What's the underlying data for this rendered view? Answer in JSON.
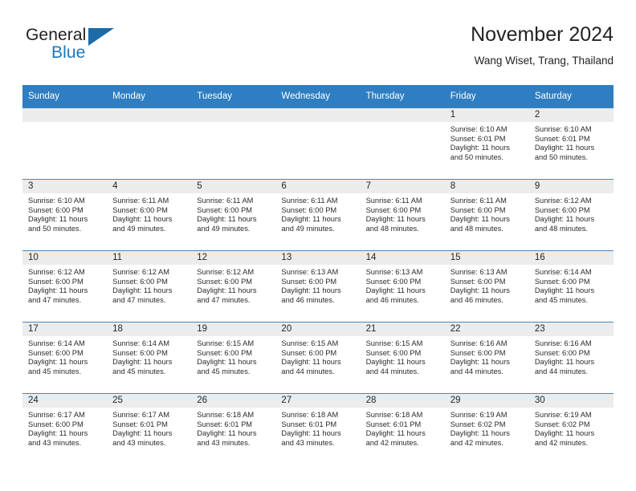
{
  "brand": {
    "name_top": "General",
    "name_bottom": "Blue",
    "accent_color": "#1b6ca8",
    "logo_icon": "triangle-flag-icon"
  },
  "header": {
    "title": "November 2024",
    "subtitle": "Wang Wiset, Trang, Thailand"
  },
  "calendar": {
    "header_bg": "#2f7ec1",
    "daynum_bg": "#ececec",
    "weekdays": [
      "Sunday",
      "Monday",
      "Tuesday",
      "Wednesday",
      "Thursday",
      "Friday",
      "Saturday"
    ],
    "weeks": [
      [
        {
          "day": "",
          "empty": true
        },
        {
          "day": "",
          "empty": true
        },
        {
          "day": "",
          "empty": true
        },
        {
          "day": "",
          "empty": true
        },
        {
          "day": "",
          "empty": true
        },
        {
          "day": "1",
          "sunrise": "Sunrise: 6:10 AM",
          "sunset": "Sunset: 6:01 PM",
          "daylight": "Daylight: 11 hours and 50 minutes."
        },
        {
          "day": "2",
          "sunrise": "Sunrise: 6:10 AM",
          "sunset": "Sunset: 6:01 PM",
          "daylight": "Daylight: 11 hours and 50 minutes."
        }
      ],
      [
        {
          "day": "3",
          "sunrise": "Sunrise: 6:10 AM",
          "sunset": "Sunset: 6:00 PM",
          "daylight": "Daylight: 11 hours and 50 minutes."
        },
        {
          "day": "4",
          "sunrise": "Sunrise: 6:11 AM",
          "sunset": "Sunset: 6:00 PM",
          "daylight": "Daylight: 11 hours and 49 minutes."
        },
        {
          "day": "5",
          "sunrise": "Sunrise: 6:11 AM",
          "sunset": "Sunset: 6:00 PM",
          "daylight": "Daylight: 11 hours and 49 minutes."
        },
        {
          "day": "6",
          "sunrise": "Sunrise: 6:11 AM",
          "sunset": "Sunset: 6:00 PM",
          "daylight": "Daylight: 11 hours and 49 minutes."
        },
        {
          "day": "7",
          "sunrise": "Sunrise: 6:11 AM",
          "sunset": "Sunset: 6:00 PM",
          "daylight": "Daylight: 11 hours and 48 minutes."
        },
        {
          "day": "8",
          "sunrise": "Sunrise: 6:11 AM",
          "sunset": "Sunset: 6:00 PM",
          "daylight": "Daylight: 11 hours and 48 minutes."
        },
        {
          "day": "9",
          "sunrise": "Sunrise: 6:12 AM",
          "sunset": "Sunset: 6:00 PM",
          "daylight": "Daylight: 11 hours and 48 minutes."
        }
      ],
      [
        {
          "day": "10",
          "sunrise": "Sunrise: 6:12 AM",
          "sunset": "Sunset: 6:00 PM",
          "daylight": "Daylight: 11 hours and 47 minutes."
        },
        {
          "day": "11",
          "sunrise": "Sunrise: 6:12 AM",
          "sunset": "Sunset: 6:00 PM",
          "daylight": "Daylight: 11 hours and 47 minutes."
        },
        {
          "day": "12",
          "sunrise": "Sunrise: 6:12 AM",
          "sunset": "Sunset: 6:00 PM",
          "daylight": "Daylight: 11 hours and 47 minutes."
        },
        {
          "day": "13",
          "sunrise": "Sunrise: 6:13 AM",
          "sunset": "Sunset: 6:00 PM",
          "daylight": "Daylight: 11 hours and 46 minutes."
        },
        {
          "day": "14",
          "sunrise": "Sunrise: 6:13 AM",
          "sunset": "Sunset: 6:00 PM",
          "daylight": "Daylight: 11 hours and 46 minutes."
        },
        {
          "day": "15",
          "sunrise": "Sunrise: 6:13 AM",
          "sunset": "Sunset: 6:00 PM",
          "daylight": "Daylight: 11 hours and 46 minutes."
        },
        {
          "day": "16",
          "sunrise": "Sunrise: 6:14 AM",
          "sunset": "Sunset: 6:00 PM",
          "daylight": "Daylight: 11 hours and 45 minutes."
        }
      ],
      [
        {
          "day": "17",
          "sunrise": "Sunrise: 6:14 AM",
          "sunset": "Sunset: 6:00 PM",
          "daylight": "Daylight: 11 hours and 45 minutes."
        },
        {
          "day": "18",
          "sunrise": "Sunrise: 6:14 AM",
          "sunset": "Sunset: 6:00 PM",
          "daylight": "Daylight: 11 hours and 45 minutes."
        },
        {
          "day": "19",
          "sunrise": "Sunrise: 6:15 AM",
          "sunset": "Sunset: 6:00 PM",
          "daylight": "Daylight: 11 hours and 45 minutes."
        },
        {
          "day": "20",
          "sunrise": "Sunrise: 6:15 AM",
          "sunset": "Sunset: 6:00 PM",
          "daylight": "Daylight: 11 hours and 44 minutes."
        },
        {
          "day": "21",
          "sunrise": "Sunrise: 6:15 AM",
          "sunset": "Sunset: 6:00 PM",
          "daylight": "Daylight: 11 hours and 44 minutes."
        },
        {
          "day": "22",
          "sunrise": "Sunrise: 6:16 AM",
          "sunset": "Sunset: 6:00 PM",
          "daylight": "Daylight: 11 hours and 44 minutes."
        },
        {
          "day": "23",
          "sunrise": "Sunrise: 6:16 AM",
          "sunset": "Sunset: 6:00 PM",
          "daylight": "Daylight: 11 hours and 44 minutes."
        }
      ],
      [
        {
          "day": "24",
          "sunrise": "Sunrise: 6:17 AM",
          "sunset": "Sunset: 6:00 PM",
          "daylight": "Daylight: 11 hours and 43 minutes."
        },
        {
          "day": "25",
          "sunrise": "Sunrise: 6:17 AM",
          "sunset": "Sunset: 6:01 PM",
          "daylight": "Daylight: 11 hours and 43 minutes."
        },
        {
          "day": "26",
          "sunrise": "Sunrise: 6:18 AM",
          "sunset": "Sunset: 6:01 PM",
          "daylight": "Daylight: 11 hours and 43 minutes."
        },
        {
          "day": "27",
          "sunrise": "Sunrise: 6:18 AM",
          "sunset": "Sunset: 6:01 PM",
          "daylight": "Daylight: 11 hours and 43 minutes."
        },
        {
          "day": "28",
          "sunrise": "Sunrise: 6:18 AM",
          "sunset": "Sunset: 6:01 PM",
          "daylight": "Daylight: 11 hours and 42 minutes."
        },
        {
          "day": "29",
          "sunrise": "Sunrise: 6:19 AM",
          "sunset": "Sunset: 6:02 PM",
          "daylight": "Daylight: 11 hours and 42 minutes."
        },
        {
          "day": "30",
          "sunrise": "Sunrise: 6:19 AM",
          "sunset": "Sunset: 6:02 PM",
          "daylight": "Daylight: 11 hours and 42 minutes."
        }
      ]
    ]
  }
}
